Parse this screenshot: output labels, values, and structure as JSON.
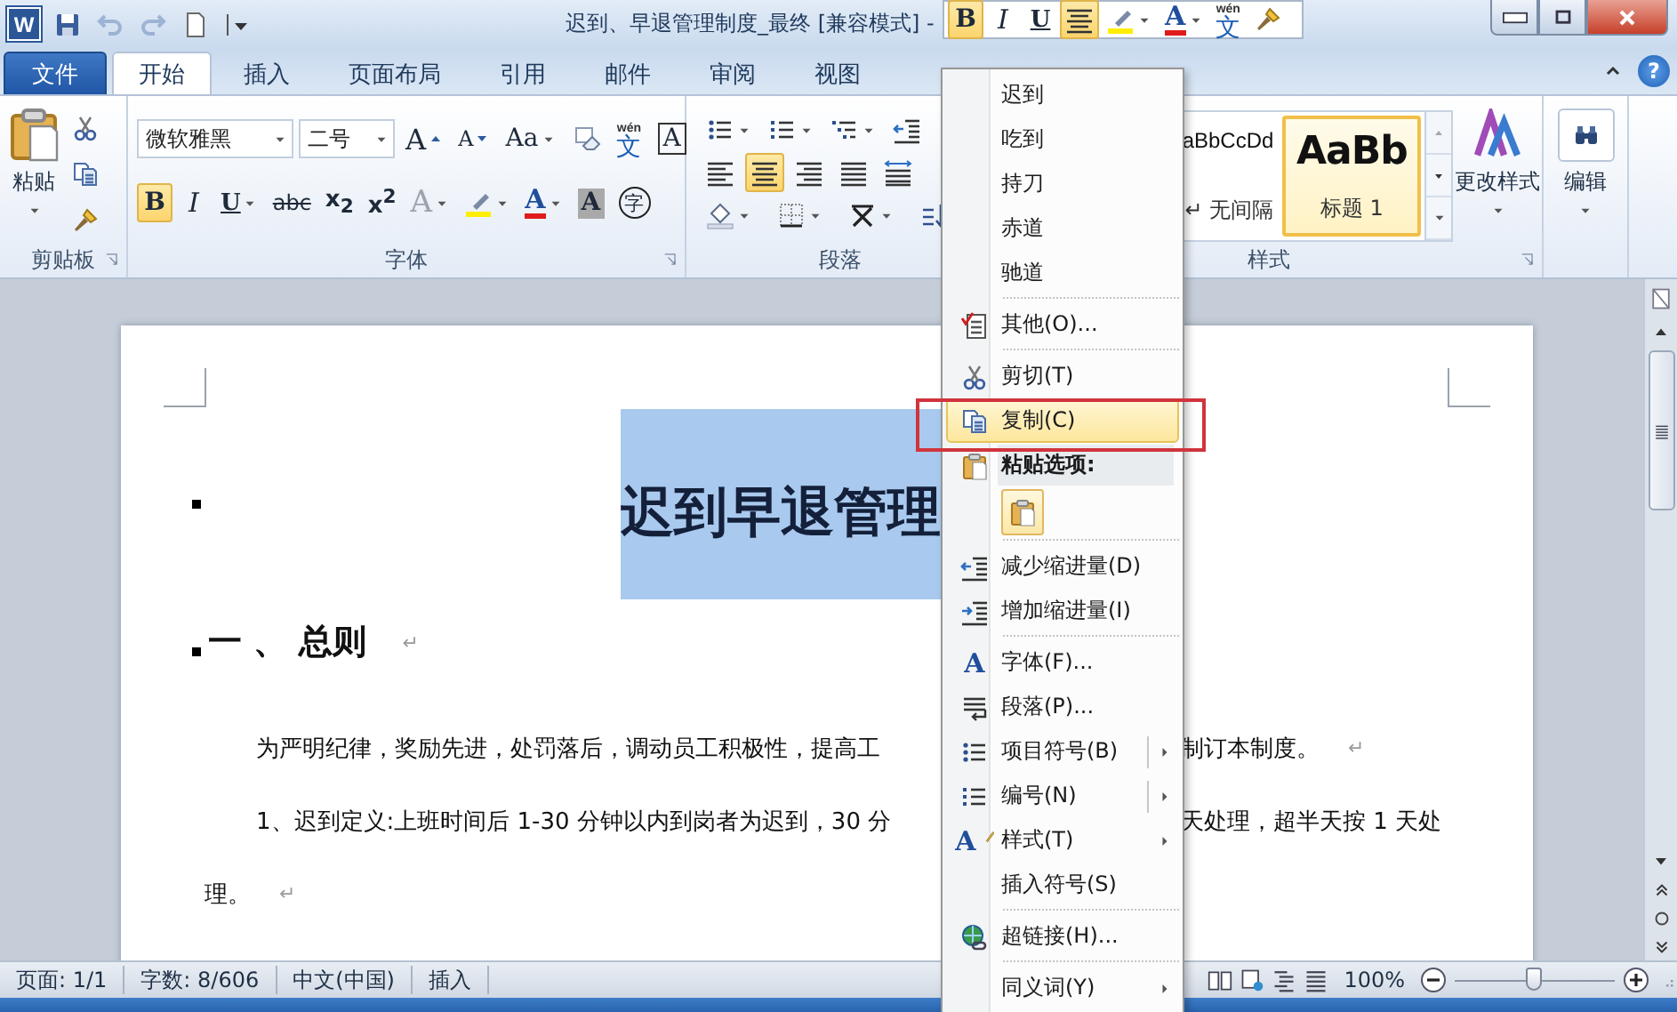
{
  "title_bar": {
    "logo": "W",
    "title": "迟到、早退管理制度_最终 [兼容模式] -",
    "quick_access": [
      {
        "kind": "save",
        "disabled": false
      },
      {
        "kind": "undo",
        "disabled": true
      },
      {
        "kind": "redo",
        "disabled": true
      },
      {
        "kind": "new",
        "disabled": false
      },
      {
        "kind": "customize",
        "disabled": false
      }
    ]
  },
  "mini_toolbar": {
    "items": [
      {
        "kind": "bold",
        "label": "B",
        "selected": true
      },
      {
        "kind": "italic",
        "label": "I",
        "selected": false
      },
      {
        "kind": "underline",
        "label": "U",
        "selected": false
      },
      {
        "kind": "align-center",
        "selected": true
      },
      {
        "kind": "highlight",
        "selected": false,
        "dropdown": true
      },
      {
        "kind": "font-color",
        "label": "A",
        "selected": false,
        "dropdown": true
      },
      {
        "kind": "phonetic",
        "label": "文",
        "ruby": "wén",
        "selected": false
      },
      {
        "kind": "format-painter",
        "selected": false
      }
    ]
  },
  "tabs": [
    {
      "label": "文件",
      "kind": "file",
      "selected": false
    },
    {
      "label": "开始",
      "kind": "tab",
      "selected": true
    },
    {
      "label": "插入",
      "kind": "tab",
      "selected": false
    },
    {
      "label": "页面布局",
      "kind": "tab",
      "selected": false
    },
    {
      "label": "引用",
      "kind": "tab",
      "selected": false
    },
    {
      "label": "邮件",
      "kind": "tab",
      "selected": false
    },
    {
      "label": "审阅",
      "kind": "tab",
      "selected": false
    },
    {
      "label": "视图",
      "kind": "tab",
      "selected": false
    }
  ],
  "help": "?",
  "ribbon": {
    "groups": [
      {
        "kind": "clipboard",
        "label": "剪贴板",
        "launcher": true,
        "paste": "粘贴",
        "tools": [
          {
            "kind": "cut"
          },
          {
            "kind": "copy"
          },
          {
            "kind": "format-painter"
          }
        ]
      },
      {
        "kind": "font",
        "label": "字体",
        "launcher": true,
        "font_name": "微软雅黑",
        "font_size": "二号",
        "top_row": [
          {
            "kind": "grow-font",
            "label": "A",
            "selected": false
          },
          {
            "kind": "shrink-font",
            "label": "A",
            "selected": false
          },
          {
            "kind": "change-case",
            "label": "Aa",
            "selected": false,
            "dropdown": true
          },
          {
            "kind": "clear-format",
            "selected": false
          },
          {
            "kind": "phonetic",
            "label": "文",
            "ruby": "wén",
            "selected": false
          },
          {
            "kind": "char-border",
            "label": "A",
            "selected": false
          }
        ],
        "bottom_row": [
          {
            "kind": "bold",
            "label": "B",
            "selected": true
          },
          {
            "kind": "italic",
            "label": "I",
            "selected": false
          },
          {
            "kind": "underline",
            "label": "U",
            "selected": false,
            "dropdown": true
          },
          {
            "kind": "strike",
            "label": "abc",
            "selected": false
          },
          {
            "kind": "subscript",
            "label": "x$_{2}$",
            "selected": false
          },
          {
            "kind": "superscript",
            "label": "x$^{2}$",
            "selected": false
          },
          {
            "kind": "text-effect",
            "label": "A",
            "selected": false,
            "dropdown": true,
            "disabled": true
          },
          {
            "kind": "highlight",
            "selected": false,
            "dropdown": true
          },
          {
            "kind": "font-color",
            "label": "A",
            "selected": false,
            "dropdown": true
          },
          {
            "kind": "char-shading",
            "label": "A",
            "selected": false
          },
          {
            "kind": "enclose",
            "label": "字",
            "selected": false
          }
        ]
      },
      {
        "kind": "paragraph",
        "label": "段落",
        "row_1": [
          {
            "kind": "bullets",
            "selected": false,
            "dropdown": true
          },
          {
            "kind": "numbering",
            "selected": false,
            "dropdown": true
          },
          {
            "kind": "multilevel",
            "selected": false,
            "dropdown": true
          },
          {
            "kind": "decrease-indent",
            "selected": false
          }
        ],
        "row_2": [
          {
            "kind": "align-left",
            "selected": false
          },
          {
            "kind": "align-center",
            "selected": true
          },
          {
            "kind": "align-right",
            "selected": false
          },
          {
            "kind": "justify",
            "selected": false
          },
          {
            "kind": "distribute",
            "selected": false
          }
        ],
        "row_3": [
          {
            "kind": "shading",
            "selected": false,
            "dropdown": true
          },
          {
            "kind": "borders",
            "selected": false,
            "dropdown": true
          },
          {
            "kind": "asian-layout",
            "selected": false,
            "dropdown": true
          },
          {
            "kind": "sort",
            "selected": false
          }
        ]
      },
      {
        "kind": "styles",
        "label": "样式",
        "launcher": true,
        "change_styles": "更改样式",
        "gallery": [
          {
            "preview": "aBbCcDd",
            "label": "↵ 无间隔",
            "kind": "normal",
            "selected": false
          },
          {
            "preview": "AaBb",
            "label": "标题 1",
            "kind": "heading",
            "selected": true
          }
        ]
      },
      {
        "kind": "editing",
        "button": "编辑"
      }
    ]
  },
  "document": {
    "title": "迟到早退管理",
    "title_selected": true,
    "heading": "一 、 总则",
    "heading_mark": "↵",
    "lines": [
      {
        "kind": "first-line",
        "left": "为严明纪律，奖励先进，处罚落后，调动员工积极性，提高工",
        "right": "制订本制度。",
        "mark": "↵"
      },
      {
        "kind": "first-line",
        "left": "1、迟到定义:上班时间后 1-30 分钟以内到岗者为迟到，30 分",
        "right": "天处理，超半天按 1 天处"
      },
      {
        "kind": "continuation",
        "left": "理。",
        "mark": "↵"
      }
    ]
  },
  "context_menu": {
    "sections": [
      [
        {
          "kind": "suggestion",
          "label": "迟到",
          "selected": false,
          "submenu": false
        },
        {
          "kind": "suggestion",
          "label": "吃到",
          "selected": false,
          "submenu": false
        },
        {
          "kind": "suggestion",
          "label": "持刀",
          "selected": false,
          "submenu": false
        },
        {
          "kind": "suggestion",
          "label": "赤道",
          "selected": false,
          "submenu": false
        },
        {
          "kind": "suggestion",
          "label": "驰道",
          "selected": false,
          "submenu": false
        }
      ],
      [
        {
          "kind": "more",
          "label": "其他(O)...",
          "selected": false,
          "submenu": false
        }
      ],
      [
        {
          "kind": "cut",
          "label": "剪切(T)",
          "selected": false,
          "submenu": false
        },
        {
          "kind": "copy",
          "label": "复制(C)",
          "selected": true,
          "submenu": false
        },
        {
          "kind": "paste-header",
          "label": "粘贴选项:",
          "selected": false,
          "submenu": false
        },
        {
          "kind": "paste-option",
          "selected": false
        }
      ],
      [
        {
          "kind": "decrease-indent",
          "label": "减少缩进量(D)",
          "selected": false,
          "submenu": false
        },
        {
          "kind": "increase-indent",
          "label": "增加缩进量(I)",
          "selected": false,
          "submenu": false
        }
      ],
      [
        {
          "kind": "font",
          "label": "字体(F)...",
          "icon_text": "A",
          "selected": false,
          "submenu": false
        },
        {
          "kind": "paragraph",
          "label": "段落(P)...",
          "selected": false,
          "submenu": false
        },
        {
          "kind": "bullets",
          "label": "项目符号(B)",
          "selected": false,
          "submenu": true,
          "split": true
        },
        {
          "kind": "numbering",
          "label": "编号(N)",
          "selected": false,
          "submenu": true,
          "split": true
        },
        {
          "kind": "style",
          "label": "样式(T)",
          "icon_text": "A",
          "selected": false,
          "submenu": true
        },
        {
          "kind": "plain",
          "label": "插入符号(S)",
          "selected": false,
          "submenu": false
        }
      ],
      [
        {
          "kind": "hyperlink",
          "label": "超链接(H)...",
          "selected": false,
          "submenu": false
        }
      ],
      [
        {
          "kind": "plain",
          "label": "同义词(Y)",
          "selected": false,
          "submenu": true
        }
      ]
    ]
  },
  "annotation_box": true,
  "status_bar": {
    "items": [
      "页面: 1/1",
      "字数: 8/606",
      "中文(中国)",
      "插入"
    ],
    "views": [
      {
        "kind": "reading",
        "selected": false
      },
      {
        "kind": "web",
        "selected": false
      },
      {
        "kind": "outline",
        "selected": false
      },
      {
        "kind": "draft",
        "selected": false
      }
    ],
    "zoom": {
      "label": "100%",
      "level": 0.5
    }
  }
}
